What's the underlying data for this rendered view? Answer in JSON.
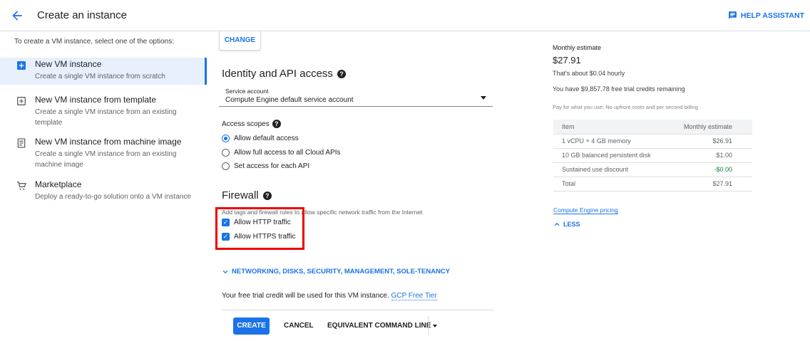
{
  "header": {
    "title": "Create an instance",
    "help_assistant": "HELP ASSISTANT"
  },
  "left": {
    "intro": "To create a VM instance, select one of the options:",
    "options": [
      {
        "title": "New VM instance",
        "desc": "Create a single VM instance from scratch",
        "icon": "add-box-icon",
        "selected": true
      },
      {
        "title": "New VM instance from template",
        "desc": "Create a single VM instance from an existing template",
        "icon": "template-icon",
        "selected": false
      },
      {
        "title": "New VM instance from machine image",
        "desc": "Create a single VM instance from an existing machine image",
        "icon": "machine-image-icon",
        "selected": false
      },
      {
        "title": "Marketplace",
        "desc": "Deploy a ready-to-go solution onto a VM instance",
        "icon": "cart-icon",
        "selected": false
      }
    ]
  },
  "main": {
    "change_label": "CHANGE",
    "identity_title": "Identity and API access",
    "service_account": {
      "label": "Service account",
      "value": "Compute Engine default service account"
    },
    "scopes_title": "Access scopes",
    "scopes": [
      {
        "label": "Allow default access",
        "checked": true
      },
      {
        "label": "Allow full access to all Cloud APIs",
        "checked": false
      },
      {
        "label": "Set access for each API",
        "checked": false
      }
    ],
    "firewall_title": "Firewall",
    "firewall_desc": "Add tags and firewall rules to allow specific network traffic from the Internet",
    "firewall_rules": [
      {
        "label": "Allow HTTP traffic",
        "checked": true
      },
      {
        "label": "Allow HTTPS traffic",
        "checked": true
      }
    ],
    "networking_link": "NETWORKING, DISKS, SECURITY, MANAGEMENT, SOLE-TENANCY",
    "trial_text": "Your free trial credit will be used for this VM instance.",
    "trial_link": "GCP Free Tier",
    "buttons": {
      "create": "CREATE",
      "cancel": "CANCEL",
      "equivalent": "EQUIVALENT COMMAND LINE"
    }
  },
  "estimate": {
    "heading": "Monthly estimate",
    "price": "$27.91",
    "hourly": "That's about $0.04 hourly",
    "credits": "You have $9,857.78 free trial credits remaining",
    "billing": "Pay for what you use: No upfront costs and per second billing",
    "table_headers": [
      "Item",
      "Monthly estimate"
    ],
    "rows": [
      [
        "1 vCPU + 4 GB memory",
        "$26.91"
      ],
      [
        "10 GB balanced persistent disk",
        "$1.00"
      ],
      [
        "Sustained use discount",
        "-$0.00"
      ],
      [
        "Total",
        "$27.91"
      ]
    ],
    "pricing_link": "Compute Engine pricing",
    "less_link": "LESS"
  },
  "colors": {
    "accent": "#1a73e8",
    "highlight_box": "#e00000",
    "selected_bg": "#e8f0fe"
  }
}
